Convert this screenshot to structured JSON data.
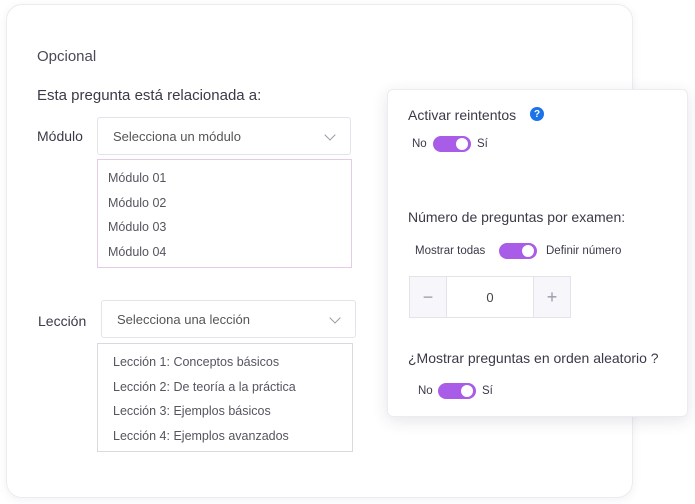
{
  "main": {
    "section_title": "Opcional",
    "question_heading": "Esta pregunta está relacionada a:",
    "module": {
      "label": "Módulo",
      "placeholder": "Selecciona un módulo",
      "options": [
        "Módulo 01",
        "Módulo 02",
        "Módulo 03",
        "Módulo 04"
      ]
    },
    "lesson": {
      "label": "Lección",
      "placeholder": "Selecciona una lección",
      "options": [
        "Lección 1: Conceptos básicos",
        "Lección 2: De teoría a la práctica",
        "Lección 3: Ejemplos básicos",
        "Lección 4: Ejemplos avanzados"
      ]
    }
  },
  "side": {
    "retries": {
      "title": "Activar reintentos",
      "help": "?",
      "off_label": "No",
      "on_label": "Sí",
      "enabled": true
    },
    "questions_count": {
      "title": "Número de preguntas por examen:",
      "off_label": "Mostrar todas",
      "on_label": "Definir número",
      "enabled": true,
      "stepper": {
        "minus": "−",
        "value": "0",
        "plus": "+"
      }
    },
    "random_order": {
      "title": "¿Mostrar preguntas en orden aleatorio ?",
      "off_label": "No",
      "on_label": "Sí",
      "enabled": true
    }
  },
  "colors": {
    "accent": "#a85ce8",
    "help": "#1a73e8"
  }
}
